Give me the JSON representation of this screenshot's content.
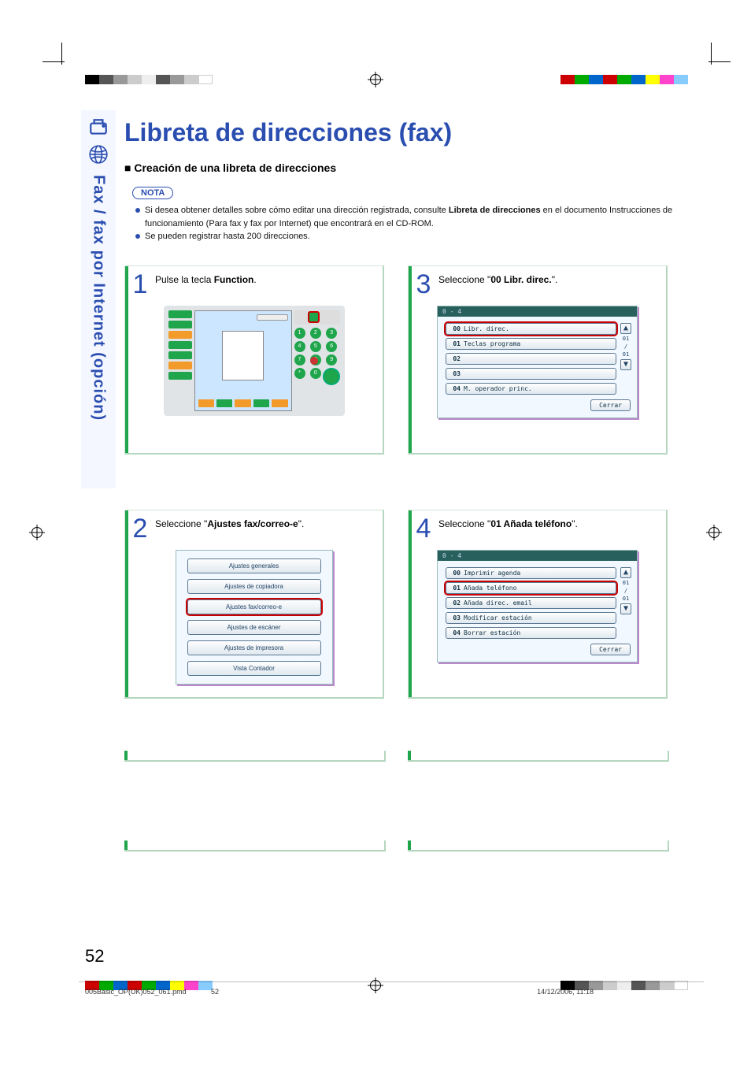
{
  "sideTab": {
    "label": "Fax / fax por Internet (opción)"
  },
  "title": "Libreta de direcciones (fax)",
  "section": "Creación de una libreta de direcciones",
  "nota": {
    "badge": "NOTA",
    "items": [
      {
        "pre": "Si desea obtener detalles sobre cómo editar una dirección registrada, consulte ",
        "strong": "Libreta de direcciones",
        "post": " en el documento Instrucciones de funcionamiento (Para fax y fax por Internet) que encontrará en el CD-ROM."
      },
      {
        "pre": "Se pueden registrar hasta 200 direcciones.",
        "strong": "",
        "post": ""
      }
    ]
  },
  "steps": {
    "s1": {
      "num": "1",
      "pre": "Pulse la tecla ",
      "kw": "Function",
      "post": "."
    },
    "s2": {
      "num": "2",
      "pre": "Seleccione \"",
      "kw": "Ajustes fax/correo-e",
      "post": "\"."
    },
    "s3": {
      "num": "3",
      "pre": "Seleccione \"",
      "kw": "00 Libr. direc.",
      "post": "\"."
    },
    "s4": {
      "num": "4",
      "pre": "Seleccione \"",
      "kw": "01 Añada teléfono",
      "post": "\"."
    }
  },
  "menu2": {
    "items": [
      "Ajustes generales",
      "Ajustes de copiadora",
      "Ajustes fax/correo-e",
      "Ajustes de escáner",
      "Ajustes de impresora",
      "Vista Contador"
    ],
    "highlightIndex": 2
  },
  "screen3": {
    "crumb": "0 - 4",
    "rows": [
      {
        "num": "00",
        "label": "Libr. direc."
      },
      {
        "num": "01",
        "label": "Teclas programa"
      },
      {
        "num": "02",
        "label": ""
      },
      {
        "num": "03",
        "label": ""
      },
      {
        "num": "04",
        "label": "M. operador princ."
      }
    ],
    "scroll": {
      "top": "01",
      "sep": "/",
      "bot": "01"
    },
    "close": "Cerrar",
    "highlightIndex": 0
  },
  "screen4": {
    "crumb": "0 - 4",
    "rows": [
      {
        "num": "00",
        "label": "Imprimir agenda"
      },
      {
        "num": "01",
        "label": "Añada teléfono"
      },
      {
        "num": "02",
        "label": "Añada direc. email"
      },
      {
        "num": "03",
        "label": "Modificar estación"
      },
      {
        "num": "04",
        "label": "Borrar estación"
      }
    ],
    "scroll": {
      "top": "01",
      "sep": "/",
      "bot": "01"
    },
    "close": "Cerrar",
    "highlightIndex": 1
  },
  "pageNumber": "52",
  "footer": {
    "file": "005Basic_OP(UK)052_061.pmd",
    "mid": "52",
    "date": "14/12/2006, 11:18"
  }
}
